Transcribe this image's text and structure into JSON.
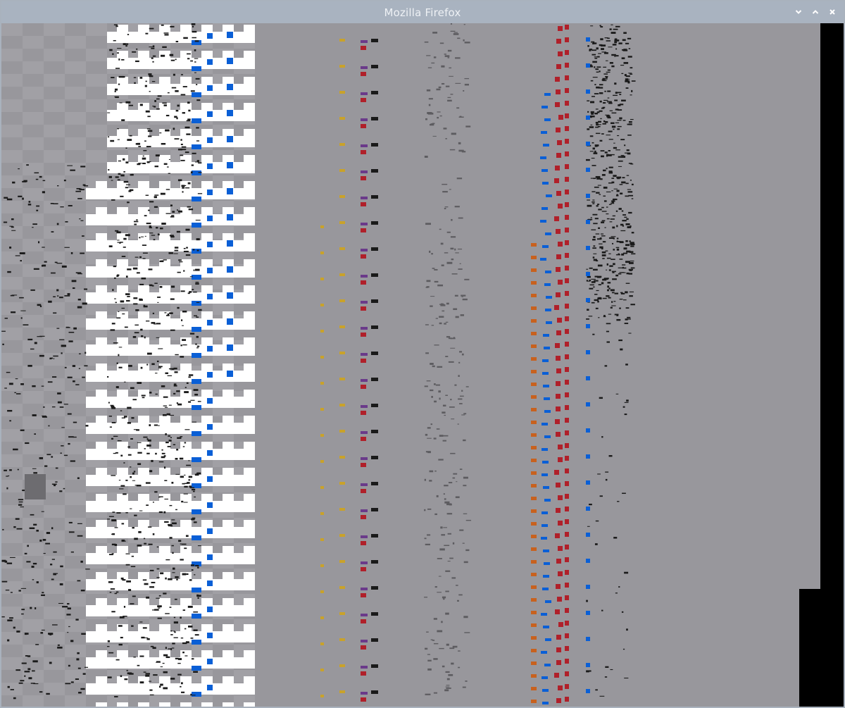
{
  "window": {
    "title": "Mozilla Firefox",
    "controls": [
      {
        "name": "minimize-button",
        "icon": "chevron-down-icon"
      },
      {
        "name": "maximize-button",
        "icon": "chevron-up-icon"
      },
      {
        "name": "close-button",
        "icon": "close-icon"
      }
    ]
  },
  "colors": {
    "titlebar": "#a9b3c0",
    "title_text": "#eef1f5",
    "content_bg": "#98979c",
    "tile_light": "#a1a0a5",
    "tile_white": "#ffffff",
    "accent_blue": "#0a5fd6",
    "accent_red": "#b0202a",
    "accent_orange": "#c8611e",
    "accent_purple": "#6a3a8a",
    "accent_gold": "#c9a22a",
    "glitch_dark": "#1a1a1a",
    "black_region": "#000000"
  }
}
